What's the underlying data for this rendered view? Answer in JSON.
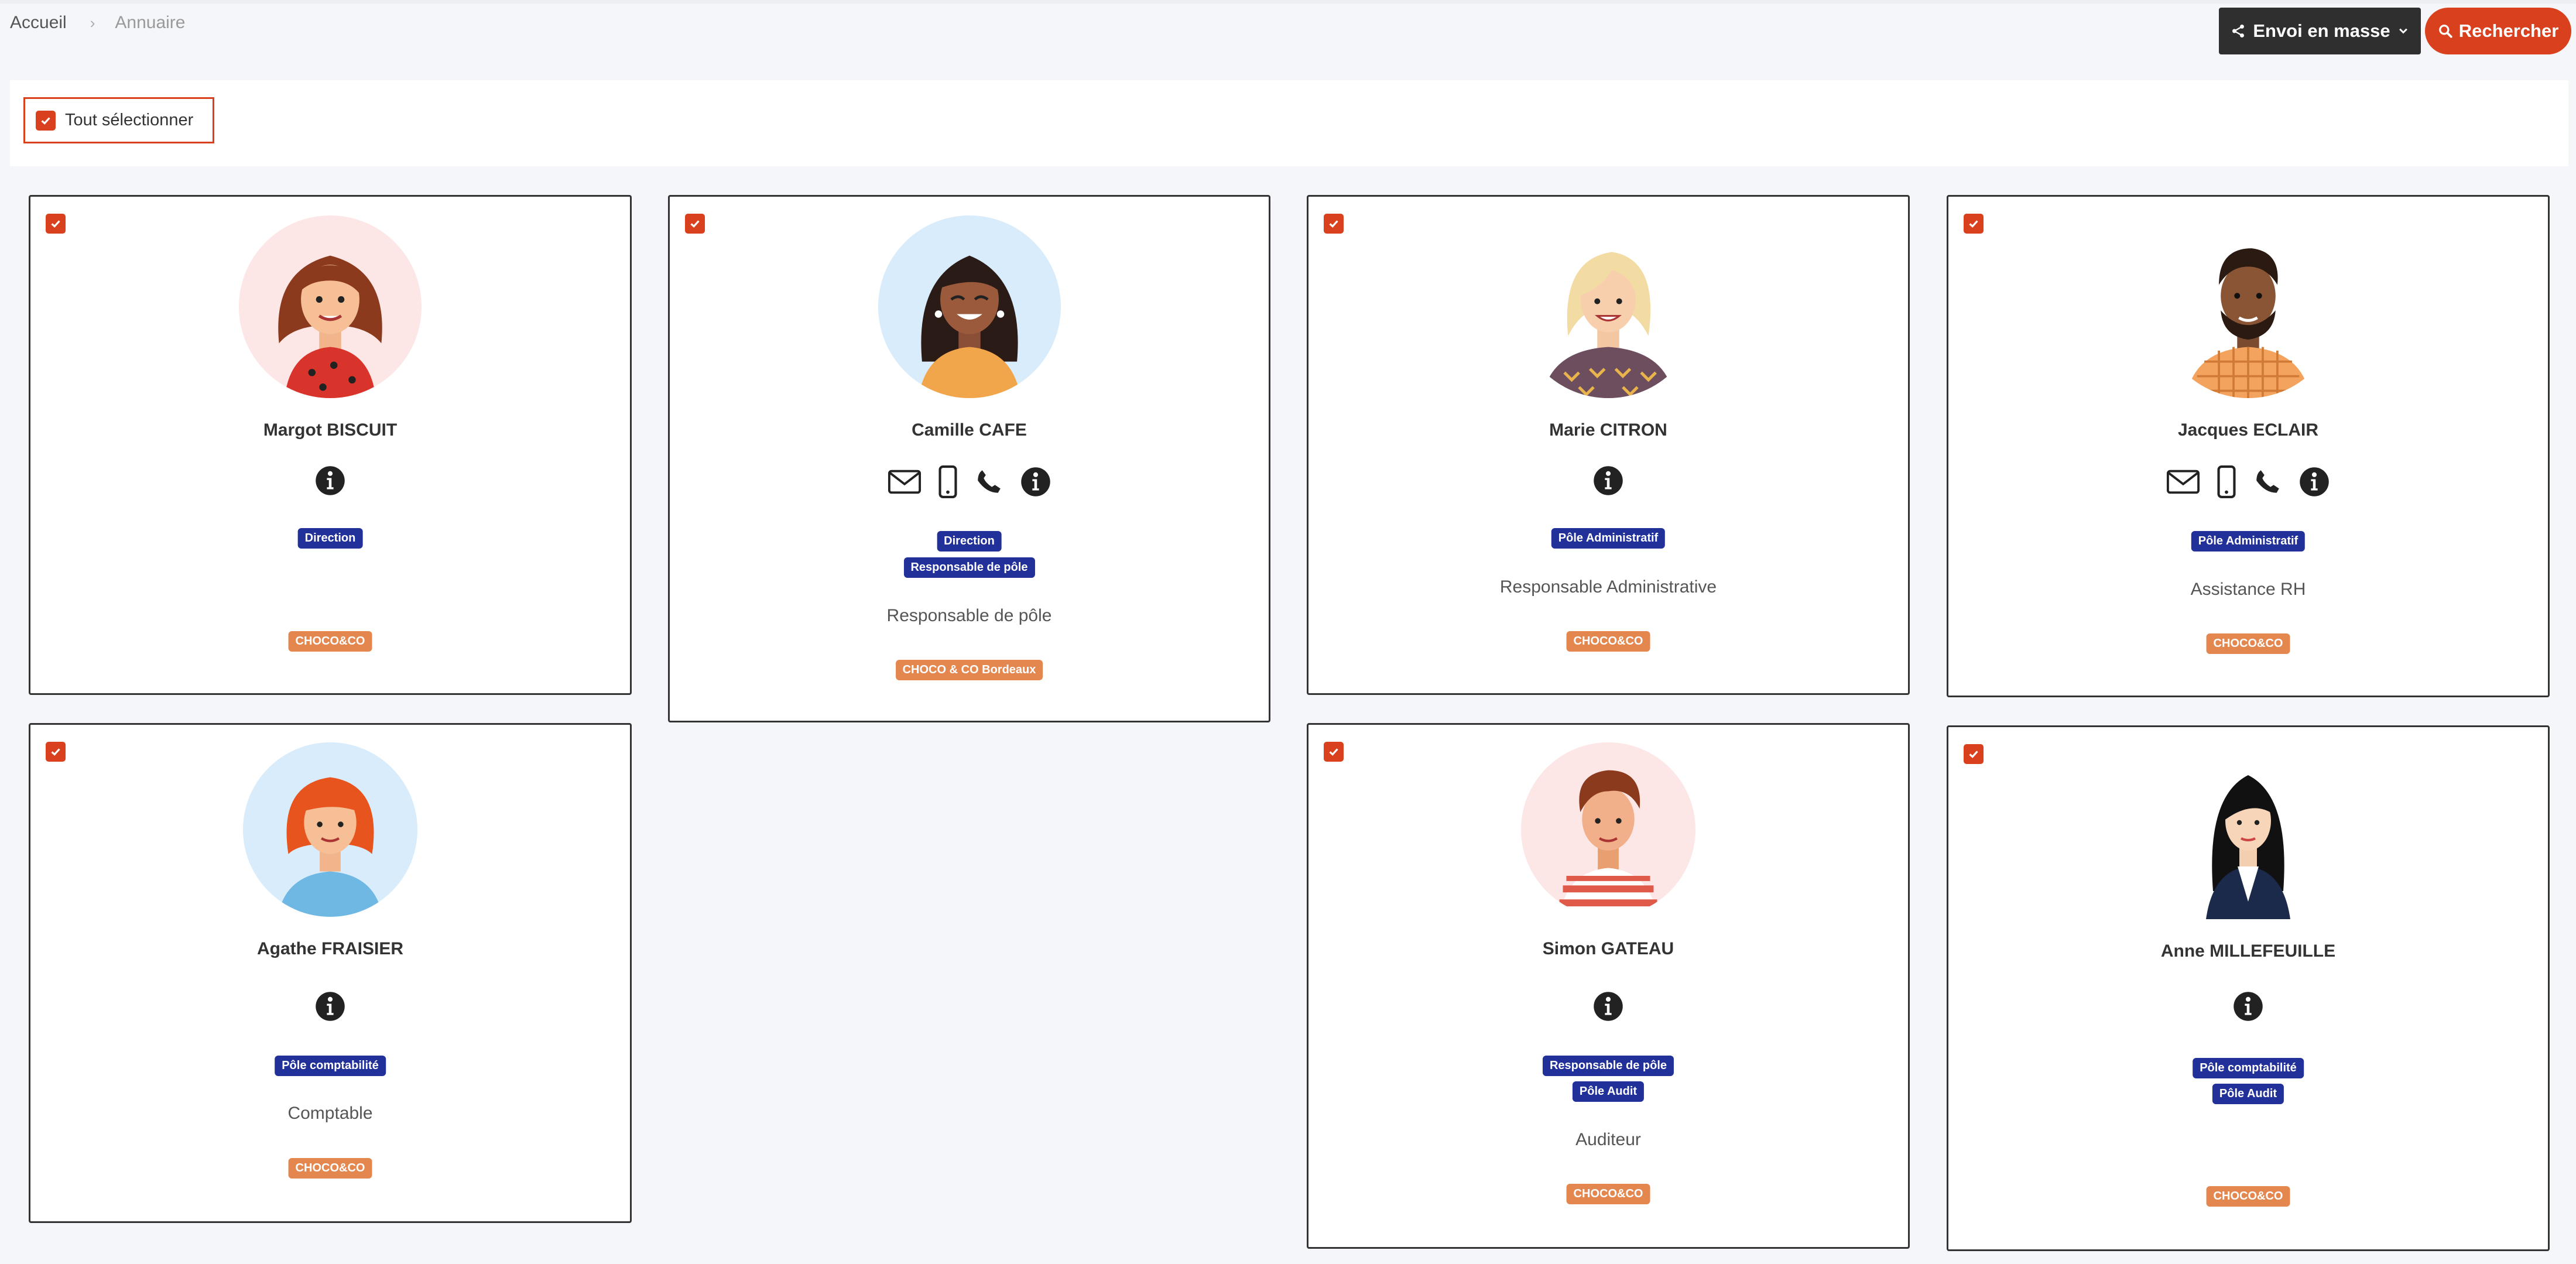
{
  "breadcrumb": {
    "home": "Accueil",
    "separator": "›",
    "current": "Annuaire"
  },
  "toolbar": {
    "mass_send": "Envoi en masse",
    "search": "Rechercher"
  },
  "select_all": {
    "label": "Tout sélectionner",
    "checked": true
  },
  "colors": {
    "accent": "#d9411e",
    "tag_blue": "#22319a",
    "tag_orange": "#e4874f",
    "dark_button": "#2f2f2f"
  },
  "contacts": [
    {
      "name": "Margot BISCUIT",
      "checked": true,
      "tags": [
        "Direction"
      ],
      "job": "",
      "company": "CHOCO&CO",
      "icons": [
        "info-icon"
      ]
    },
    {
      "name": "Camille CAFE",
      "checked": true,
      "tags": [
        "Direction",
        "Responsable de pôle"
      ],
      "job": "Responsable de pôle",
      "company": "CHOCO & CO Bordeaux",
      "icons": [
        "email-icon",
        "mobile-icon",
        "phone-icon",
        "info-icon"
      ]
    },
    {
      "name": "Marie CITRON",
      "checked": true,
      "tags": [
        "Pôle Administratif"
      ],
      "job": "Responsable Administrative",
      "company": "CHOCO&CO",
      "icons": [
        "info-icon"
      ]
    },
    {
      "name": "Jacques ECLAIR",
      "checked": true,
      "tags": [
        "Pôle Administratif"
      ],
      "job": "Assistance RH",
      "company": "CHOCO&CO",
      "icons": [
        "email-icon",
        "mobile-icon",
        "phone-icon",
        "info-icon"
      ]
    },
    {
      "name": "Agathe FRAISIER",
      "checked": true,
      "tags": [
        "Pôle comptabilité"
      ],
      "job": "Comptable",
      "company": "CHOCO&CO",
      "icons": [
        "info-icon"
      ]
    },
    {
      "name": "Simon GATEAU",
      "checked": true,
      "tags": [
        "Responsable de pôle",
        "Pôle Audit"
      ],
      "job": "Auditeur",
      "company": "CHOCO&CO",
      "icons": [
        "info-icon"
      ]
    },
    {
      "name": "Anne MILLEFEUILLE",
      "checked": true,
      "tags": [
        "Pôle comptabilité",
        "Pôle Audit"
      ],
      "job": "",
      "company": "CHOCO&CO",
      "icons": [
        "info-icon"
      ]
    }
  ]
}
